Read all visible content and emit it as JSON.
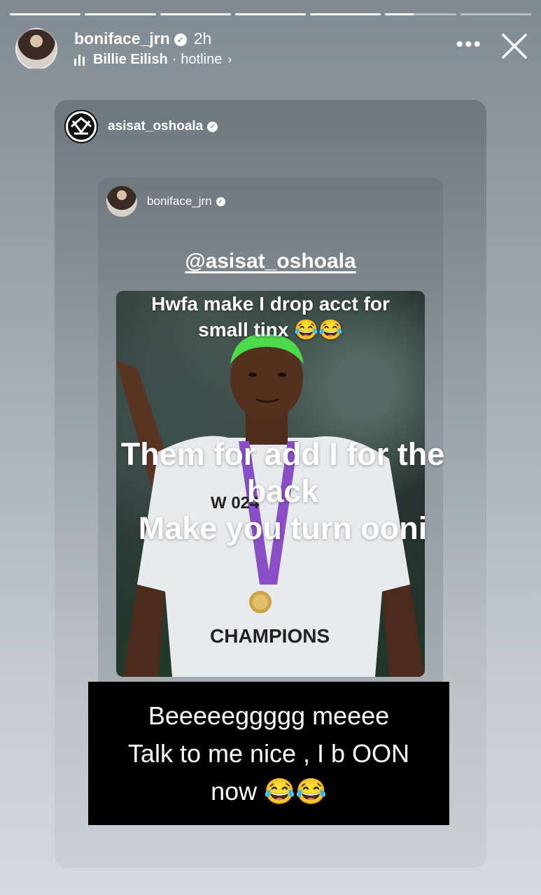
{
  "story": {
    "progress_segments": [
      1,
      1,
      1,
      1,
      1,
      0.4,
      0
    ],
    "username": "boniface_jrn",
    "time_ago": "2h",
    "music_artist": "Billie Eilish",
    "music_separator": "·",
    "music_song": "hotline",
    "more_icon": "more-horizontal-icon",
    "close_icon": "close-icon"
  },
  "repost": {
    "username": "asisat_oshoala",
    "inner_username": "boniface_jrn",
    "mention": "@asisat_oshoala",
    "photo_caption_line1": "Hwfa make I drop acct for",
    "photo_caption_line2": "small tinx 😂😂",
    "overlay_line1": "Them for add I for the",
    "overlay_line2": "back",
    "overlay_line3": "Make you turn ooni",
    "shirt_text_top": "W   024",
    "shirt_text_bottom": "CHAMPIONS"
  },
  "reply_box": {
    "line1": "Beeeeeggggg meeee",
    "line2": "Talk to me nice , I b OON",
    "line3": "now 😂😂"
  }
}
